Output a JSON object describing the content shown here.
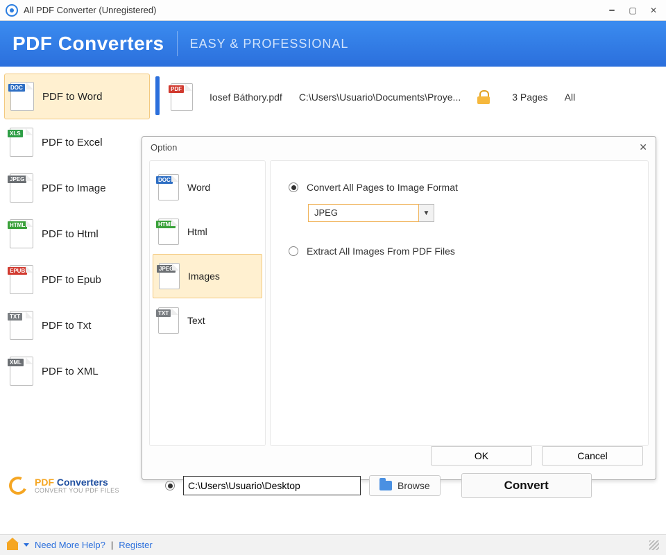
{
  "window": {
    "title": "All PDF Converter (Unregistered)"
  },
  "brand": {
    "name": "PDF Converters",
    "tagline": "EASY & PROFESSIONAL"
  },
  "sidebar": {
    "items": [
      {
        "label": "PDF to Word",
        "badge": "DOC",
        "badgeClass": "doc",
        "selected": true
      },
      {
        "label": "PDF to Excel",
        "badge": "XLS",
        "badgeClass": "xls",
        "selected": false
      },
      {
        "label": "PDF to Image",
        "badge": "JPEG",
        "badgeClass": "jpeg",
        "selected": false
      },
      {
        "label": "PDF to Html",
        "badge": "HTML",
        "badgeClass": "html",
        "selected": false
      },
      {
        "label": "PDF to Epub",
        "badge": "EPUB",
        "badgeClass": "epub",
        "selected": false
      },
      {
        "label": "PDF to Txt",
        "badge": "TXT",
        "badgeClass": "txt",
        "selected": false
      },
      {
        "label": "PDF to XML",
        "badge": "XML",
        "badgeClass": "xml",
        "selected": false
      }
    ]
  },
  "file": {
    "badge": "PDF",
    "name": "Iosef Báthory.pdf",
    "path": "C:\\Users\\Usuario\\Documents\\Proye...",
    "pages": "3 Pages",
    "range": "All"
  },
  "dialog": {
    "title": "Option",
    "items": [
      {
        "label": "Word",
        "badge": "DOC",
        "badgeClass": "doc",
        "selected": false
      },
      {
        "label": "Html",
        "badge": "HTML",
        "badgeClass": "html",
        "selected": false
      },
      {
        "label": "Images",
        "badge": "JPEG",
        "badgeClass": "jpeg",
        "selected": true
      },
      {
        "label": "Text",
        "badge": "TXT",
        "badgeClass": "txt",
        "selected": false
      }
    ],
    "radios": {
      "convert_all": {
        "label": "Convert All Pages to Image Format",
        "checked": true
      },
      "extract": {
        "label": "Extract All Images From PDF Files",
        "checked": false
      }
    },
    "format_selected": "JPEG",
    "ok": "OK",
    "cancel": "Cancel"
  },
  "output": {
    "path": "C:\\Users\\Usuario\\Desktop",
    "browse": "Browse",
    "convert": "Convert"
  },
  "small_brand": {
    "line1a": "PDF ",
    "line1b": "Converters",
    "line2": "CONVERT YOU PDF FILES"
  },
  "status": {
    "help": "Need More Help?",
    "sep": "  |",
    "register": "Register"
  }
}
